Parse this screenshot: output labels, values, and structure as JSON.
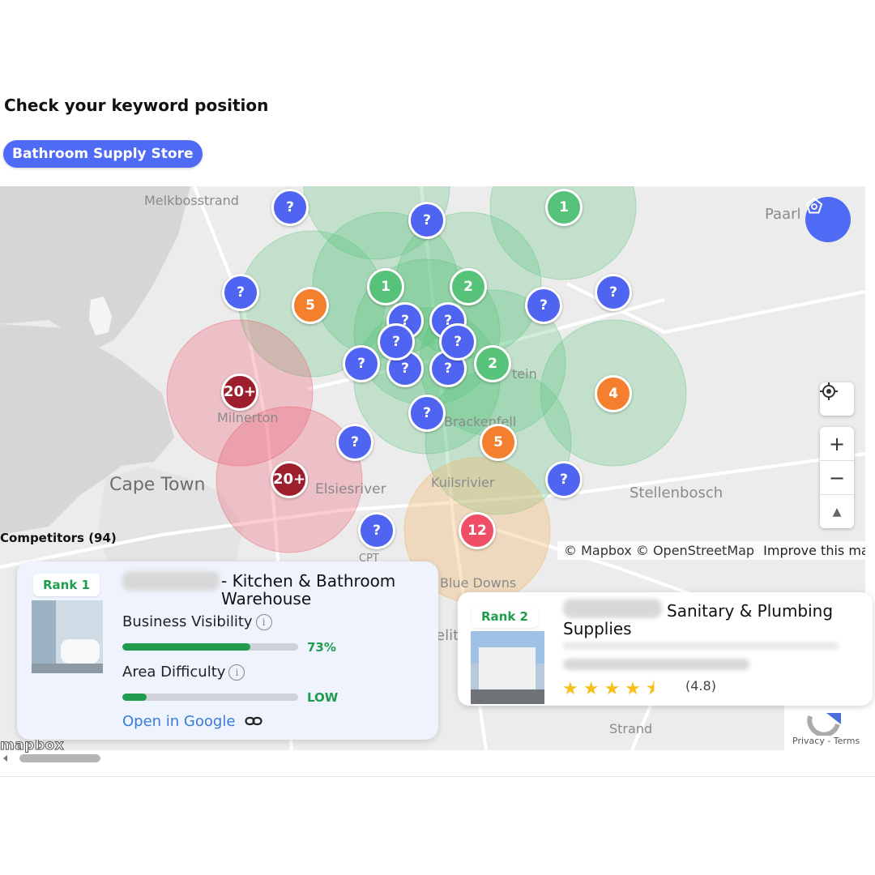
{
  "page": {
    "title": "Check your keyword position"
  },
  "keyword": {
    "label": "Bathroom Supply Store"
  },
  "map": {
    "places": [
      {
        "name": "Melkbosstrand"
      },
      {
        "name": "Paarl"
      },
      {
        "name": "Milnerton"
      },
      {
        "name": "Cape Town"
      },
      {
        "name": "Elsiesriver"
      },
      {
        "name": "Kuilsrivier"
      },
      {
        "name": "Stellenbosch"
      },
      {
        "name": "Brackenfell"
      },
      {
        "name": "Blue Downs"
      },
      {
        "name": "Strand"
      },
      {
        "name": "CPT"
      },
      {
        "name": "tein"
      },
      {
        "name": "elit"
      }
    ],
    "markers": [
      {
        "label": "?",
        "color": "blue"
      },
      {
        "label": "?",
        "color": "blue"
      },
      {
        "label": "1",
        "color": "green"
      },
      {
        "label": "?",
        "color": "blue"
      },
      {
        "label": "5",
        "color": "orange"
      },
      {
        "label": "1",
        "color": "green"
      },
      {
        "label": "2",
        "color": "green"
      },
      {
        "label": "?",
        "color": "blue"
      },
      {
        "label": "?",
        "color": "blue"
      },
      {
        "label": "?",
        "color": "blue"
      },
      {
        "label": "?",
        "color": "blue"
      },
      {
        "label": "?",
        "color": "blue"
      },
      {
        "label": "?",
        "color": "blue"
      },
      {
        "label": "?",
        "color": "blue"
      },
      {
        "label": "?",
        "color": "blue"
      },
      {
        "label": "?",
        "color": "blue"
      },
      {
        "label": "2",
        "color": "green"
      },
      {
        "label": "20+",
        "color": "darkred"
      },
      {
        "label": "4",
        "color": "orange"
      },
      {
        "label": "?",
        "color": "blue"
      },
      {
        "label": "?",
        "color": "blue"
      },
      {
        "label": "5",
        "color": "orange"
      },
      {
        "label": "20+",
        "color": "darkred"
      },
      {
        "label": "?",
        "color": "blue"
      },
      {
        "label": "?",
        "color": "blue"
      },
      {
        "label": "12",
        "color": "red"
      }
    ],
    "controls": {
      "locate_icon": "crosshair-icon",
      "zoom_in": "+",
      "zoom_out": "−",
      "compass": "▲"
    },
    "attribution": {
      "mapbox": "© Mapbox",
      "osm": "© OpenStreetMap",
      "improve": "Improve this map"
    },
    "logo": "mapbox",
    "captcha": {
      "text": "Privacy - Terms"
    }
  },
  "competitors": {
    "label": "Competitors (94)"
  },
  "card1": {
    "rank": "Rank 1",
    "title": "- Kitchen & Bathroom Warehouse",
    "visibility_label": "Business Visibility",
    "visibility_value": "73%",
    "visibility_fraction": 0.73,
    "difficulty_label": "Area Difficulty",
    "difficulty_value": "LOW",
    "difficulty_fraction": 0.14,
    "link": "Open in Google"
  },
  "card2": {
    "rank": "Rank 2",
    "title": "Sanitary & Plumbing Supplies",
    "stars": "★★★★⯨",
    "rating": "(4.8)"
  },
  "colors": {
    "accent": "#4f6bf5",
    "green": "#1f9c4d",
    "blue_marker": "#4f64f0",
    "orange_marker": "#f47f2e",
    "red_marker": "#ee4f66",
    "darkred_marker": "#9d1f2e"
  }
}
